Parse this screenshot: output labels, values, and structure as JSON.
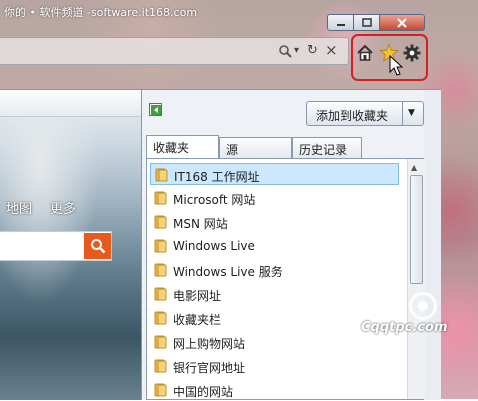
{
  "watermark_top": "你的 • 软件频道 -software.it168.com",
  "watermark_bottom": "Cqqtpc.com",
  "toolbar": {
    "home_icon": "home-icon",
    "favorites_icon": "favorites-star-icon",
    "tools_icon": "gear-icon",
    "highlight_color": "#d42020"
  },
  "address_bar": {
    "search_icon": "magnifier",
    "dropdown_icon": "▾",
    "refresh_icon": "↻",
    "stop_icon": "×"
  },
  "webpage": {
    "nav_items": [
      "地图",
      "更多"
    ]
  },
  "favorites_panel": {
    "add_button_label": "添加到收藏夹",
    "tabs": [
      "收藏夹",
      "源",
      "历史记录"
    ],
    "active_tab": "收藏夹",
    "items": [
      "IT168 工作网址",
      "Microsoft 网站",
      "MSN 网站",
      "Windows Live",
      "Windows Live 服务",
      "电影网址",
      "收藏夹栏",
      "网上购物网站",
      "银行官网地址",
      "中国的网站"
    ],
    "selected_index": 0,
    "selection_color": "#cce8ff"
  }
}
